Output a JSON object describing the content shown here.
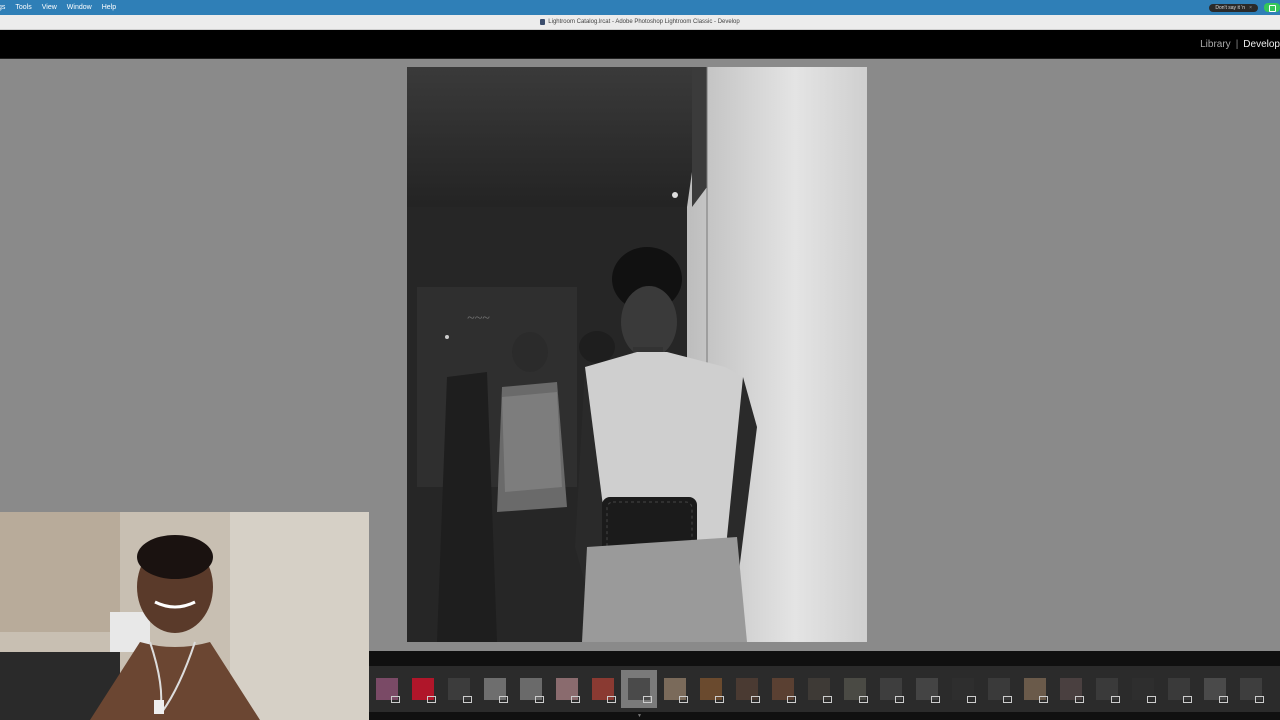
{
  "menubar": {
    "items": [
      "gs",
      "Tools",
      "View",
      "Window",
      "Help"
    ],
    "tooltip_label": "Don't say it 'n",
    "tooltip_close": "×"
  },
  "window": {
    "title": "Lightroom Catalog.lrcat - Adobe Photoshop Lightroom Classic - Develop"
  },
  "modules": {
    "library": "Library",
    "separator": "|",
    "develop": "Develop"
  },
  "filmstrip": {
    "thumb_colors": [
      "#7a4a66",
      "#b0162a",
      "#3c3c3c",
      "#6e6e6e",
      "#6a6a6a",
      "#8a6b6e",
      "#8a3a32",
      "#4a4a4a",
      "#7a6a5a",
      "#6a4a2e",
      "#4a3a32",
      "#5a4032",
      "#3e3a36",
      "#4a4a44",
      "#3e3e3e",
      "#444444",
      "#2e2e2e",
      "#3a3a3a",
      "#6a5a4a",
      "#4a4040",
      "#3a3a3a",
      "#2e2e2e",
      "#3a3a3a",
      "#4a4a4a",
      "#3e3e3e"
    ],
    "selected_index": 7
  }
}
